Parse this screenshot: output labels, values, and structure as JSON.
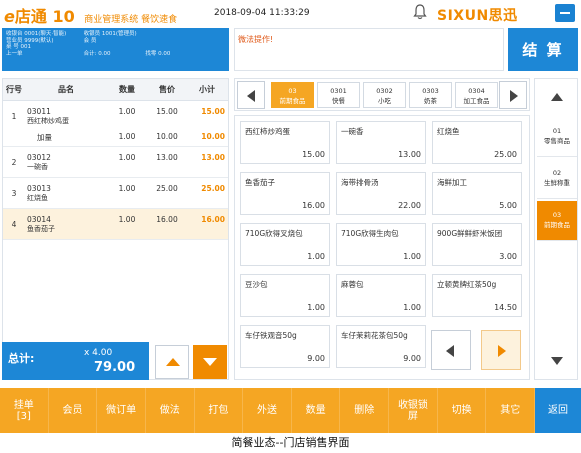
{
  "header": {
    "logo_main": "店通",
    "logo_version": "10",
    "logo_sub": "商业管理系统 餐饮速食",
    "datetime": "2018-09-04 11:33:29",
    "brand": "SIXUN思迅"
  },
  "info": {
    "rows": [
      [
        "收银台  0001(聊天·智能)",
        "收银员  1001(管理员)",
        "",
        ""
      ],
      [
        "营业员  9999(默认)",
        "会  员",
        "",
        ""
      ],
      [
        "桌  号  001",
        "",
        "",
        ""
      ],
      [
        "上一单",
        "合计:  0.00",
        "找零  0.00",
        ""
      ]
    ]
  },
  "message": "微法提作!",
  "checkout_label": "结 算",
  "order": {
    "headers": {
      "no": "行号",
      "name": "品名",
      "qty": "数量",
      "price": "售价",
      "subtotal": "小计"
    },
    "rows": [
      {
        "no": "1",
        "code": "03011",
        "name": "西红柿炒鸡蛋",
        "qty": "1.00",
        "price": "15.00",
        "subtotal": "15.00",
        "extra": {
          "name": "加量",
          "qty": "1.00",
          "price": "10.00",
          "subtotal": "10.00"
        }
      },
      {
        "no": "2",
        "code": "03012",
        "name": "一碗香",
        "qty": "1.00",
        "price": "13.00",
        "subtotal": "13.00"
      },
      {
        "no": "3",
        "code": "03013",
        "name": "红烧鱼",
        "qty": "1.00",
        "price": "25.00",
        "subtotal": "25.00"
      },
      {
        "no": "4",
        "code": "03014",
        "name": "鱼香茄子",
        "qty": "1.00",
        "price": "16.00",
        "subtotal": "16.00"
      }
    ],
    "selected_row": 3
  },
  "total": {
    "label": "总计:",
    "count": "x 4.00",
    "amount": "79.00"
  },
  "categories_top": [
    {
      "code": "03",
      "name": "前期食品",
      "active": true
    },
    {
      "code": "0301",
      "name": "快餐",
      "active": false
    },
    {
      "code": "0302",
      "name": "小吃",
      "active": false
    },
    {
      "code": "0303",
      "name": "奶茶",
      "active": false
    },
    {
      "code": "0304",
      "name": "加工食品",
      "active": false
    }
  ],
  "items": [
    {
      "name": "西红柿炒鸡蛋",
      "price": "15.00"
    },
    {
      "name": "一碗香",
      "price": "13.00"
    },
    {
      "name": "红烧鱼",
      "price": "25.00"
    },
    {
      "name": "鱼香茄子",
      "price": "16.00"
    },
    {
      "name": "海带排骨汤",
      "price": "22.00"
    },
    {
      "name": "海鲜加工",
      "price": "5.00"
    },
    {
      "name": "710G欣得叉烧包",
      "price": "1.00"
    },
    {
      "name": "710G欣得生肉包",
      "price": "1.00"
    },
    {
      "name": "900G鲜鲜虾米饭团",
      "price": "3.00"
    },
    {
      "name": "豆沙包",
      "price": "1.00"
    },
    {
      "name": "麻蓉包",
      "price": "1.00"
    },
    {
      "name": "立顿黄牌红茶50g",
      "price": "14.50"
    },
    {
      "name": "车仔铁观音50g",
      "price": "9.00"
    },
    {
      "name": "车仔茉莉花茶包50g",
      "price": "9.00"
    }
  ],
  "categories_right": [
    {
      "code": "01",
      "name": "零售商品",
      "active": false
    },
    {
      "code": "02",
      "name": "生鲜称重",
      "active": false
    },
    {
      "code": "03",
      "name": "前期食品",
      "active": true
    }
  ],
  "actions": [
    "挂单\n[3]",
    "会员",
    "微订单",
    "做法",
    "打包",
    "外送",
    "数量",
    "删除",
    "收银锁\n屏",
    "切换",
    "其它",
    "返回"
  ],
  "caption": "简餐业态--门店销售界面",
  "colors": {
    "accent": "#f08a00",
    "primary": "#1d87d6"
  }
}
